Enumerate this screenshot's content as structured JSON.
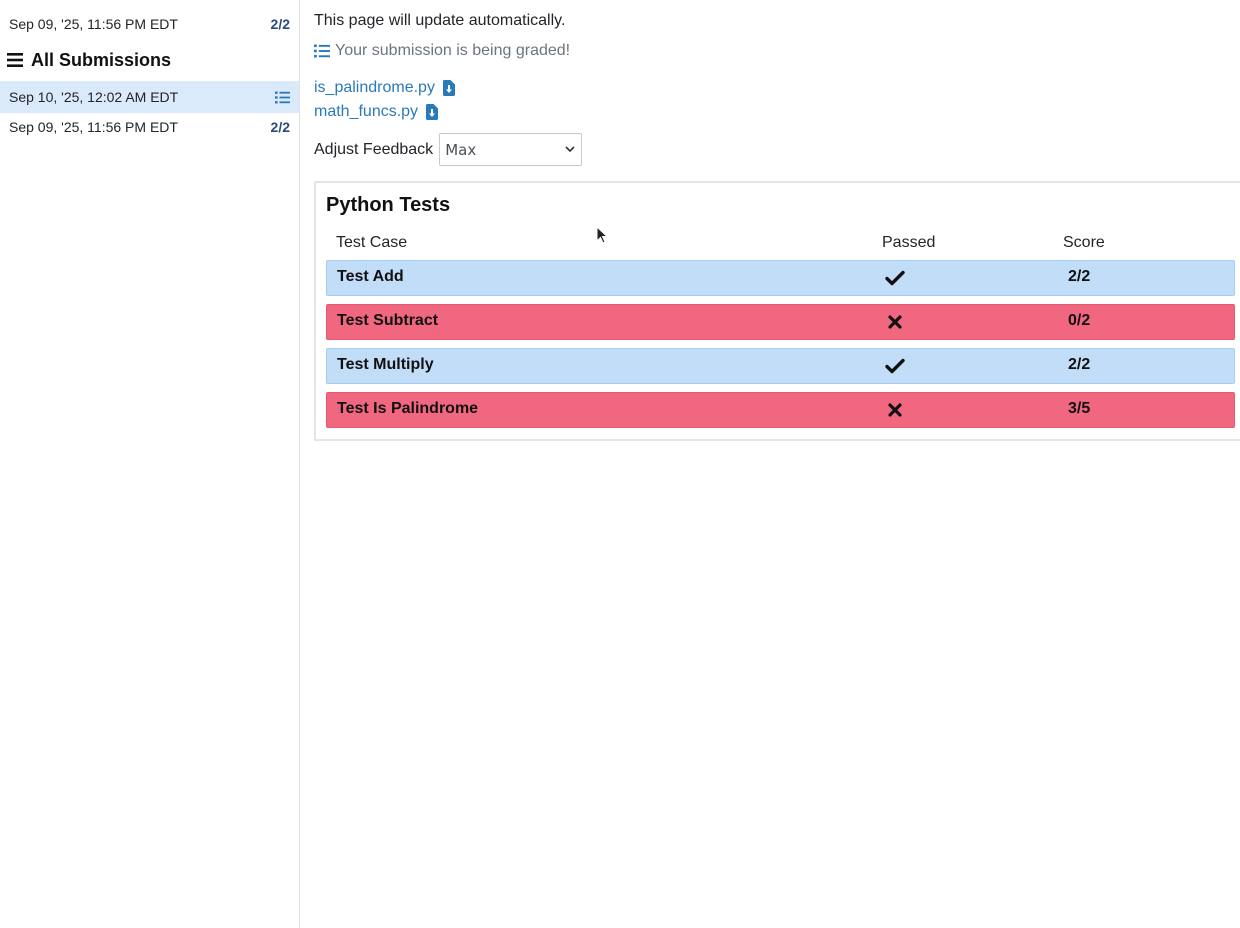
{
  "sidebar": {
    "top_submission": {
      "date": "Sep 09, '25, 11:56 PM EDT",
      "score": "2",
      "total": "2"
    },
    "all_submissions_label": "All Submissions",
    "submissions": [
      {
        "date": "Sep 10, '25, 12:02 AM EDT",
        "status": "grading",
        "active": true
      },
      {
        "date": "Sep 09, '25, 11:56 PM EDT",
        "score": "2",
        "total": "2",
        "active": false
      }
    ]
  },
  "main": {
    "update_message": "This page will update automatically.",
    "grading_message": "Your submission is being graded!",
    "files": [
      {
        "name": "is_palindrome.py"
      },
      {
        "name": "math_funcs.py"
      }
    ],
    "feedback": {
      "label": "Adjust Feedback",
      "selected": "Max"
    },
    "tests_card": {
      "title": "Python Tests",
      "headers": {
        "test_case": "Test Case",
        "passed": "Passed",
        "score": "Score"
      },
      "rows": [
        {
          "name": "Test Add",
          "passed": true,
          "score": "2/2"
        },
        {
          "name": "Test Subtract",
          "passed": false,
          "score": "0/2"
        },
        {
          "name": "Test Multiply",
          "passed": true,
          "score": "2/2"
        },
        {
          "name": "Test Is Palindrome",
          "passed": false,
          "score": "3/5"
        }
      ]
    }
  },
  "colors": {
    "pass_row": "#c2ddf8",
    "fail_row": "#f0677f",
    "link": "#2a7ab8",
    "active_submission": "#dbeafb"
  },
  "icons": {
    "menu": "hamburger-icon",
    "list": "list-icon",
    "download": "file-download-icon",
    "check": "check-icon",
    "cross": "x-icon"
  }
}
